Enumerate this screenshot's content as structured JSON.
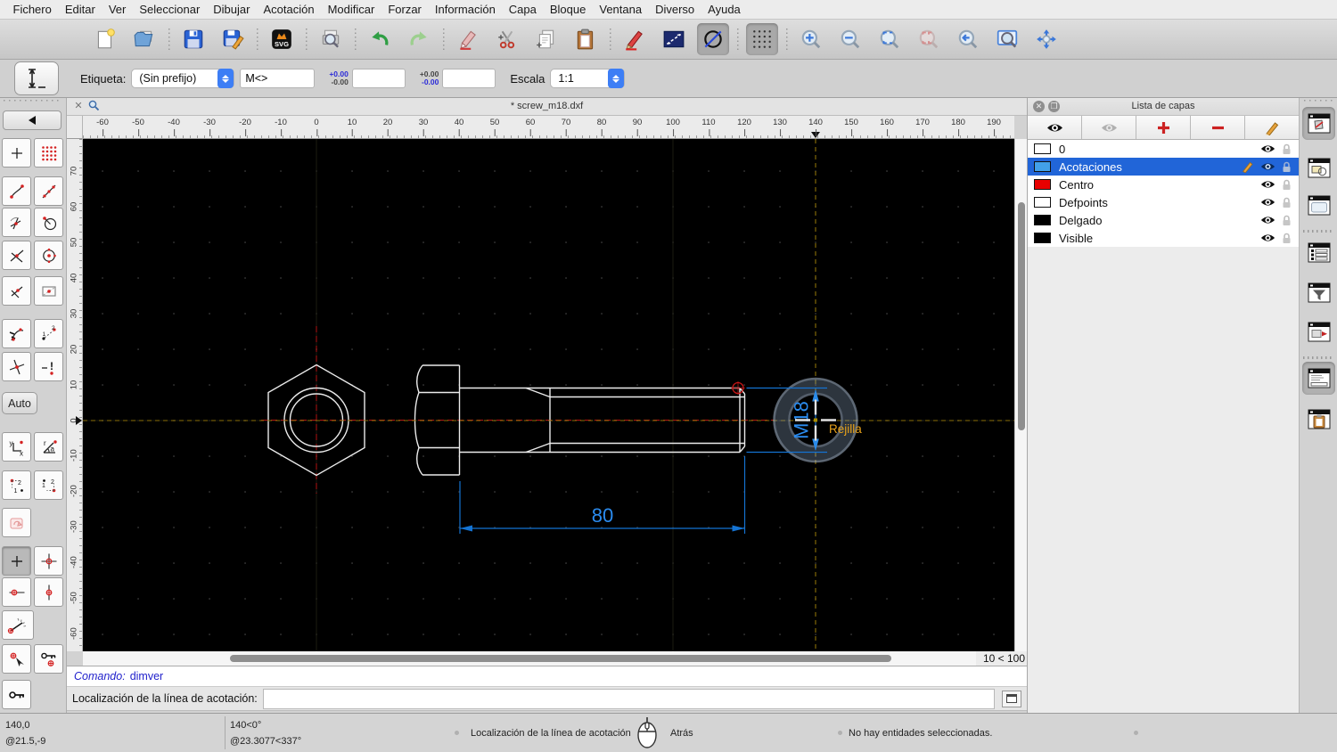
{
  "menu": {
    "items": [
      "Fichero",
      "Editar",
      "Ver",
      "Seleccionar",
      "Dibujar",
      "Acotación",
      "Modificar",
      "Forzar",
      "Información",
      "Capa",
      "Bloque",
      "Ventana",
      "Diverso",
      "Ayuda"
    ]
  },
  "toolbar": {
    "svg_icon_label": "SVG"
  },
  "options": {
    "label": "Etiqueta:",
    "prefix_value": "(Sin prefijo)",
    "text_value": "M<>",
    "tol1_top": "+0.00",
    "tol1_bottom": "-0.00",
    "tol2_top": "+0.00",
    "tol2_bottom": "-0.00",
    "tol1_value": "",
    "tol2_value": "",
    "scale_label": "Escala",
    "scale_value": "1:1"
  },
  "snap": {
    "auto_label": "Auto"
  },
  "tab": {
    "title": "* screw_m18.dxf",
    "close_glyph": "✕"
  },
  "ruler": {
    "h_labels": [
      "-60",
      "-50",
      "-40",
      "-30",
      "-20",
      "-10",
      "0",
      "10",
      "20",
      "30",
      "40",
      "50",
      "60",
      "70",
      "80",
      "90",
      "100",
      "110",
      "120",
      "130",
      "140",
      "150",
      "160",
      "170",
      "180",
      "190"
    ],
    "v_labels": [
      "70",
      "60",
      "50",
      "40",
      "30",
      "20",
      "10",
      "0",
      "-10",
      "-20",
      "-30",
      "-40",
      "-50",
      "-60"
    ]
  },
  "drawing": {
    "dim_length": "80",
    "dim_diameter": "M18",
    "snap_tooltip": "Rejilla"
  },
  "grid_status": "10 < 100",
  "command": {
    "prompt_label": "Comando:",
    "last_command": "dimver",
    "input_label": "Localización de la línea de acotación:",
    "input_value": ""
  },
  "layers": {
    "title": "Lista de capas",
    "items": [
      {
        "name": "0",
        "color": "#ffffff"
      },
      {
        "name": "Acotaciones",
        "color": "#42a0e8"
      },
      {
        "name": "Centro",
        "color": "#e80000"
      },
      {
        "name": "Defpoints",
        "color": "#ffffff"
      },
      {
        "name": "Delgado",
        "color": "#000000"
      },
      {
        "name": "Visible",
        "color": "#000000"
      }
    ]
  },
  "statusbar": {
    "abs_coord": "140,0",
    "rel_coord": "@21.5,-9",
    "abs_polar": "140<0°",
    "rel_polar": "@23.3077<337°",
    "left_action": "Localización de la línea de acotación",
    "right_action": "Atrás",
    "selection_info": "No hay entidades seleccionadas."
  },
  "colors": {
    "dimension_blue": "#1473d2",
    "dimension_text_blue": "#2b8cf0",
    "centerline_red": "#b01212",
    "crosshair_olive": "#8c7008",
    "tooltip_orange": "#e8a21a",
    "selection_highlight": "#2165d8",
    "canvas_black": "#000000"
  }
}
